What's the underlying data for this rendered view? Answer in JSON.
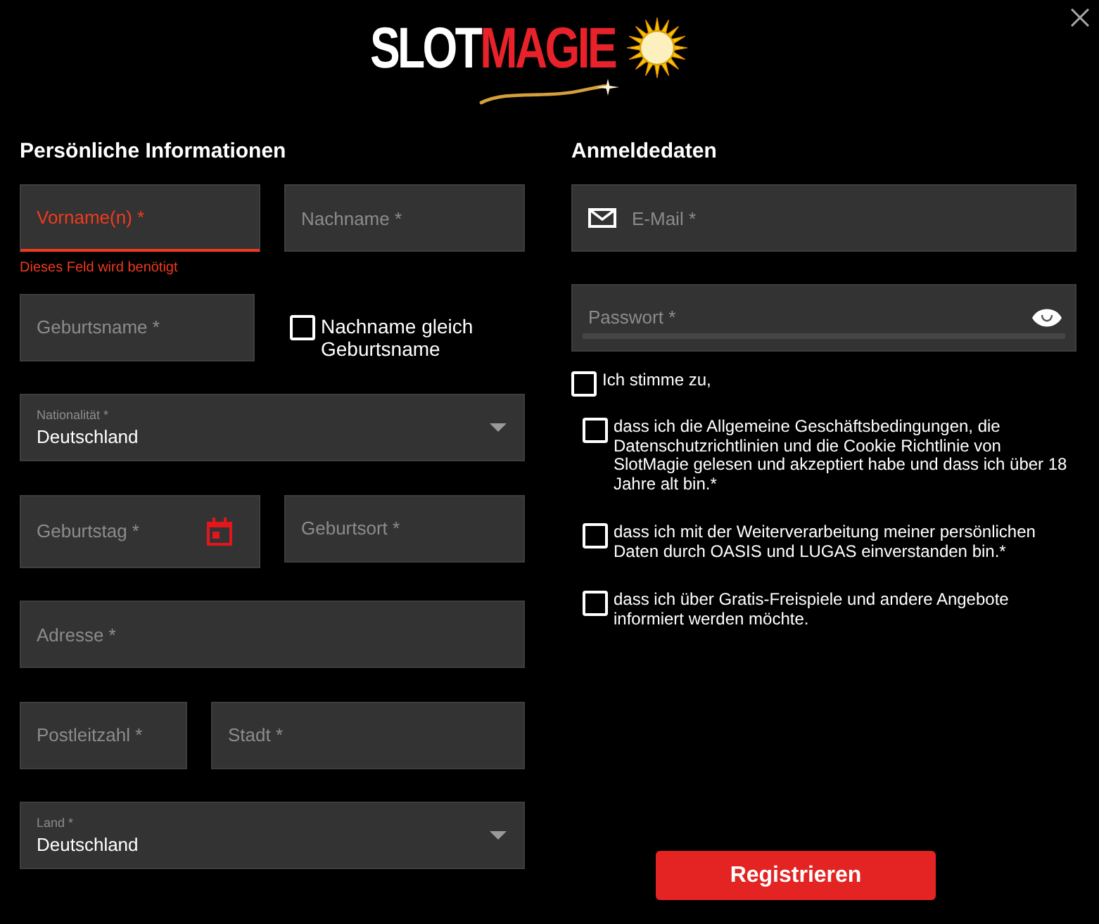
{
  "logo": {
    "parts": [
      {
        "text": "SLOT",
        "kind": "plain"
      },
      {
        "text": "MAGIE",
        "kind": "accent"
      }
    ]
  },
  "personal": {
    "heading": "Persönliche Informationen",
    "rows": [
      [
        {
          "kind": "input",
          "placeholder": "Vorname(n) *",
          "invalid": true,
          "error": "Dieses Feld wird benötigt"
        },
        {
          "kind": "input",
          "placeholder": "Nachname *",
          "invalid": false
        }
      ],
      [
        {
          "kind": "input",
          "placeholder": "Geburtsname *",
          "invalid": false
        },
        {
          "kind": "checkbox",
          "label": "Nachname gleich Geburtsname",
          "checked": false
        }
      ],
      [
        {
          "kind": "select",
          "label": "Nationalität *",
          "value": "Deutschland"
        }
      ],
      [
        {
          "kind": "date",
          "placeholder": "Geburtstag *",
          "invalid": false
        },
        {
          "kind": "input",
          "placeholder": "Geburtsort *",
          "invalid": false
        }
      ],
      [
        {
          "kind": "input",
          "placeholder": "Adresse *",
          "invalid": false
        }
      ],
      [
        {
          "kind": "input",
          "placeholder": "Postleitzahl *",
          "invalid": false
        },
        {
          "kind": "input",
          "placeholder": "Stadt *",
          "invalid": false
        }
      ],
      [
        {
          "kind": "select",
          "label": "Land *",
          "value": "Deutschland"
        }
      ]
    ]
  },
  "login": {
    "heading": "Anmeldedaten",
    "fields": [
      {
        "kind": "email",
        "placeholder": "E-Mail *"
      },
      {
        "kind": "password",
        "placeholder": "Passwort *"
      }
    ]
  },
  "consent": {
    "label": "Ich stimme zu,",
    "checked": false,
    "items": [
      {
        "text": "dass ich die Allgemeine Geschäftsbedingungen, die Datenschutzrichtlinien und die Cookie Richtlinie von SlotMagie gelesen und akzeptiert habe und dass ich über 18 Jahre alt bin.*",
        "checked": false
      },
      {
        "text": "dass ich mit der Weiterverarbeitung meiner persönlichen Daten durch OASIS und LUGAS einverstanden bin.*",
        "checked": false
      },
      {
        "text": "dass ich über Gratis-Freispiele und andere Angebote informiert werden möchte.",
        "checked": false
      }
    ]
  },
  "submit": {
    "label": "Registrieren"
  }
}
